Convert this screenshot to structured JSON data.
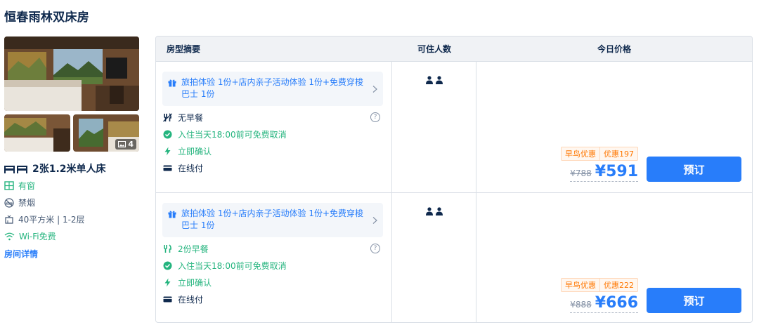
{
  "room": {
    "title": "恒春雨林双床房",
    "photo_count": "4",
    "bed": "2张1.2米单人床",
    "facilities": {
      "window": "有窗",
      "smoking": "禁烟",
      "area": "40平方米 | 1-2层",
      "wifi": "Wi-Fi免费"
    },
    "detail_link": "房间详情"
  },
  "table": {
    "headers": {
      "summary": "房型摘要",
      "occupancy": "可住人数",
      "price": "今日价格"
    },
    "rows": [
      {
        "package": "旅拍体验 1份+店内亲子活动体验 1份+免费穿梭巴士 1份",
        "meal": "无早餐",
        "meal_icon": "no-breakfast-icon",
        "cancel": "入住当天18:00前可免费取消",
        "confirm": "立即确认",
        "pay": "在线付",
        "promo_tag": "早鸟优惠",
        "discount": "优惠197",
        "old_price": "¥788",
        "price": "¥591",
        "book": "预订"
      },
      {
        "package": "旅拍体验 1份+店内亲子活动体验 1份+免费穿梭巴士 1份",
        "meal": "2份早餐",
        "meal_icon": "breakfast-icon",
        "cancel": "入住当天18:00前可免费取消",
        "confirm": "立即确认",
        "pay": "在线付",
        "promo_tag": "早鸟优惠",
        "discount": "优惠222",
        "old_price": "¥888",
        "price": "¥666",
        "book": "预订"
      }
    ]
  },
  "colors": {
    "accent": "#287dfa",
    "green": "#24b47e",
    "promo": "#ff7700",
    "text": "#0f294d"
  }
}
